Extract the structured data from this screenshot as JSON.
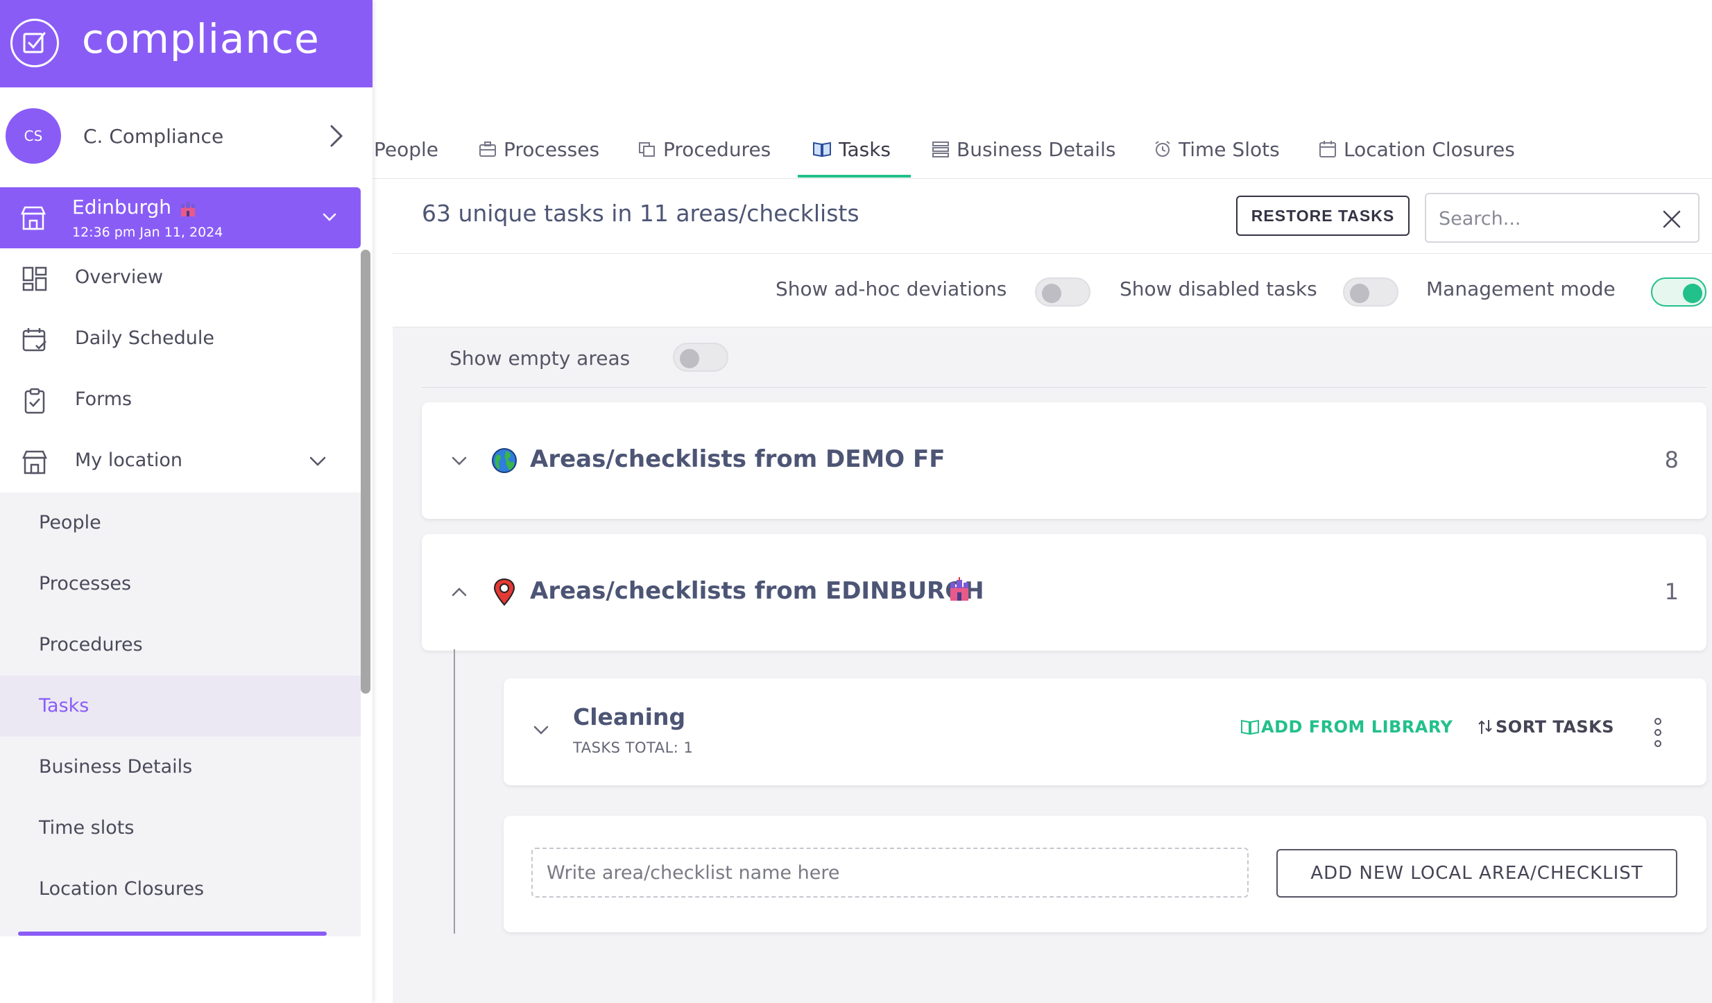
{
  "brand": {
    "name": "compliance"
  },
  "user": {
    "initials": "CS",
    "name": "C. Compliance"
  },
  "location": {
    "name": "Edinburgh",
    "time": "12:36 pm Jan 11, 2024"
  },
  "nav": {
    "overview": "Overview",
    "daily_schedule": "Daily Schedule",
    "forms": "Forms",
    "my_location": "My location"
  },
  "subnav": {
    "people": "People",
    "processes": "Processes",
    "procedures": "Procedures",
    "tasks": "Tasks",
    "business_details": "Business Details",
    "time_slots": "Time slots",
    "location_closures": "Location Closures"
  },
  "tabs": {
    "people": "People",
    "processes": "Processes",
    "procedures": "Procedures",
    "tasks": "Tasks",
    "business_details": "Business Details",
    "time_slots": "Time Slots",
    "location_closures": "Location Closures"
  },
  "summary": {
    "text": "63 unique tasks in 11 areas/checklists",
    "restore_label": "RESTORE TASKS",
    "search_placeholder": "Search..."
  },
  "toggles": {
    "adhoc": {
      "label": "Show ad-hoc deviations",
      "on": false
    },
    "disabled": {
      "label": "Show disabled tasks",
      "on": false
    },
    "management": {
      "label": "Management mode",
      "on": true
    },
    "empty": {
      "label": "Show empty areas",
      "on": false
    }
  },
  "groups": {
    "demo": {
      "title": "Areas/checklists from DEMO FF",
      "count": "8"
    },
    "edinburgh": {
      "title": "Areas/checklists from EDINBURGH",
      "count": "1"
    }
  },
  "area": {
    "title": "Cleaning",
    "subtitle": "TASKS TOTAL: 1",
    "add_from_library": "ADD FROM LIBRARY",
    "sort_tasks": "SORT TASKS"
  },
  "new_area": {
    "placeholder": "Write area/checklist name here",
    "button_label": "ADD NEW LOCAL AREA/CHECKLIST"
  },
  "colors": {
    "brand": "#8a5cf6",
    "accent_green": "#22c08a",
    "text_primary": "#4d5575"
  }
}
